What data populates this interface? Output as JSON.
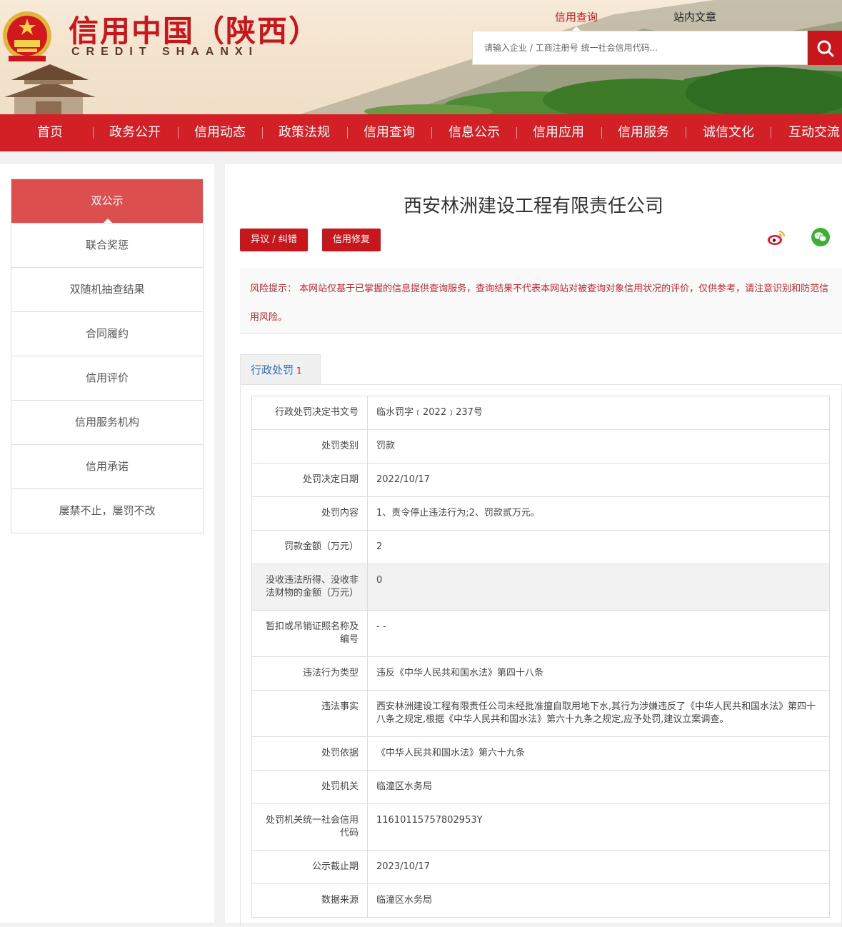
{
  "header": {
    "logo_cn": "信用中国（陕西）",
    "logo_en": "CREDIT   SHAANXI",
    "search_tabs": [
      "信用查询",
      "站内文章"
    ],
    "search_placeholder": "请输入企业 / 工商注册号 统一社会信用代码..."
  },
  "nav": [
    "首页",
    "政务公开",
    "信用动态",
    "政策法规",
    "信用查询",
    "信息公示",
    "信用应用",
    "信用服务",
    "诚信文化",
    "互动交流"
  ],
  "sidebar": [
    "双公示",
    "联合奖惩",
    "双随机抽查结果",
    "合同履约",
    "信用评价",
    "信用服务机构",
    "信用承诺",
    "屡禁不止，屡罚不改"
  ],
  "main": {
    "company": "西安林洲建设工程有限责任公司",
    "buttons": [
      "异议 / 纠错",
      "信用修复"
    ],
    "risk_label": "风险提示：",
    "risk_text": "本网站仅基于已掌握的信息提供查询服务，查询结果不代表本网站对被查询对象信用状况的评价，仅供参考，请注意识别和防范信用风险。",
    "tab_label": "行政处罚",
    "tab_count": "1",
    "rows": [
      {
        "label": "行政处罚决定书文号",
        "value": "临水罚字﹝2022﹞237号"
      },
      {
        "label": "处罚类别",
        "value": "罚款"
      },
      {
        "label": "处罚决定日期",
        "value": "2022/10/17"
      },
      {
        "label": "处罚内容",
        "value": "1、责令停止违法行为;2、罚款贰万元。"
      },
      {
        "label": "罚款金额（万元）",
        "value": "2"
      },
      {
        "label": "没收违法所得、没收非法财物的金额（万元）",
        "value": "0"
      },
      {
        "label": "暂扣或吊销证照名称及编号",
        "value": "- -"
      },
      {
        "label": "违法行为类型",
        "value": "违反《中华人民共和国水法》第四十八条"
      },
      {
        "label": "违法事实",
        "value": "西安林洲建设工程有限责任公司未经批准擅自取用地下水,其行为涉嫌违反了《中华人民共和国水法》第四十八条之规定,根据《中华人民共和国水法》第六十九条之规定,应予处罚,建议立案调查。"
      },
      {
        "label": "处罚依据",
        "value": "《中华人民共和国水法》第六十九条"
      },
      {
        "label": "处罚机关",
        "value": "临潼区水务局"
      },
      {
        "label": "处罚机关统一社会信用代码",
        "value": "11610115757802953Y"
      },
      {
        "label": "公示截止期",
        "value": "2023/10/17"
      },
      {
        "label": "数据来源",
        "value": "临潼区水务局"
      }
    ]
  },
  "colors": {
    "brand_red": "#c8161d",
    "nav_red": "#d32027",
    "sidebar_active": "#db4f4f",
    "tab_blue": "#2f6fbf"
  },
  "icons": [
    "national-emblem-icon",
    "search-icon",
    "weibo-icon",
    "wechat-icon"
  ]
}
